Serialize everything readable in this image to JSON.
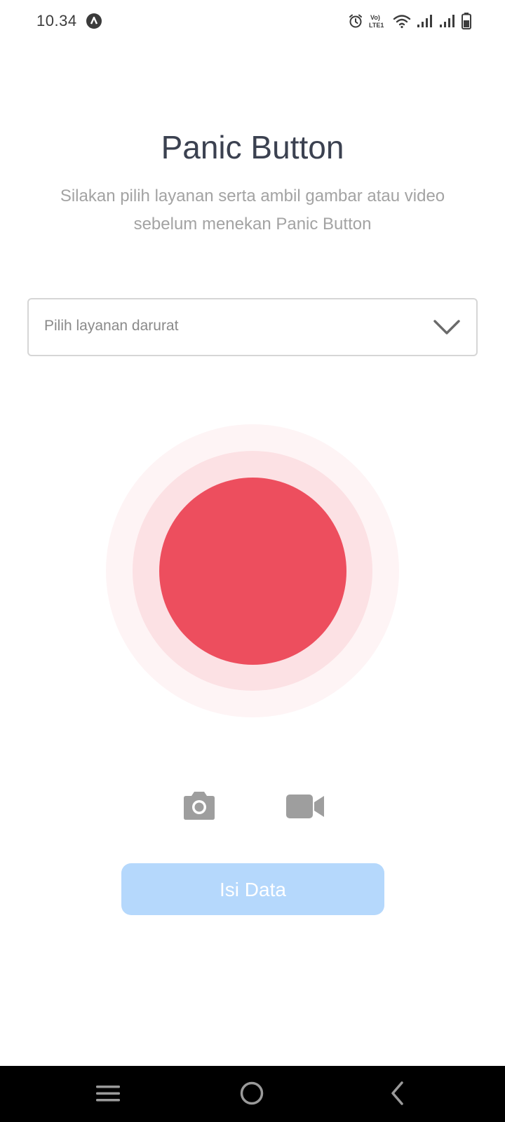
{
  "status_bar": {
    "time": "10.34",
    "lte_label_top": "Vo)",
    "lte_label_bottom": "LTE1"
  },
  "page": {
    "title": "Panic Button",
    "subtitle": "Silakan pilih layanan serta ambil gambar atau video sebelum menekan Panic Button"
  },
  "service_select": {
    "placeholder": "Pilih layanan darurat"
  },
  "actions": {
    "submit_label": "Isi Data"
  },
  "icons": {
    "status": [
      "app-badge-icon",
      "alarm-icon",
      "volte-icon",
      "wifi-icon",
      "signal-icon",
      "signal-icon",
      "battery-icon"
    ],
    "media": [
      "camera-icon",
      "video-camera-icon"
    ],
    "navigation": [
      "menu-icon",
      "home-icon",
      "back-icon"
    ]
  },
  "colors": {
    "panic_core": "#ed4e5e",
    "panic_ring_middle": "#fce1e4",
    "panic_ring_outer": "#fef4f5",
    "submit_button": "#b5d8fc",
    "title_text": "#3b4150",
    "media_icons": "#9e9e9e",
    "nav_bar": "#000000"
  }
}
